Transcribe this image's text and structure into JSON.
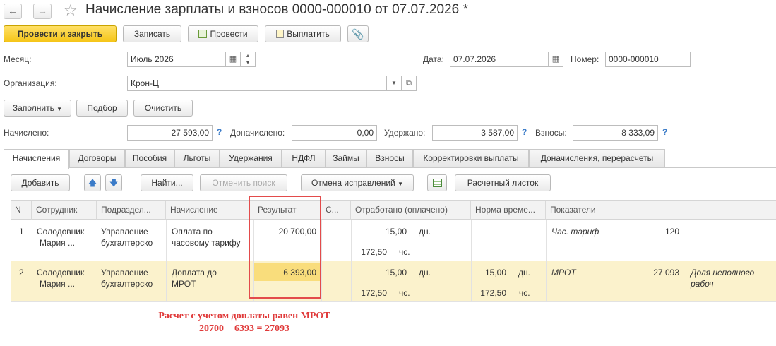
{
  "window": {
    "title": "Начисление зарплаты и взносов 0000-000010 от 07.07.2026 *",
    "back_icon": "←",
    "forward_icon": "→",
    "star_icon": "☆"
  },
  "toolbar": {
    "post_close": "Провести и закрыть",
    "save": "Записать",
    "post": "Провести",
    "pay": "Выплатить"
  },
  "header": {
    "month_label": "Месяц:",
    "month_value": "Июль 2026",
    "date_label": "Дата:",
    "date_value": "07.07.2026",
    "number_label": "Номер:",
    "number_value": "0000-000010",
    "org_label": "Организация:",
    "org_value": "Крон-Ц"
  },
  "actions": {
    "fill": "Заполнить",
    "select": "Подбор",
    "clear": "Очистить"
  },
  "totals": {
    "accrued_label": "Начислено:",
    "accrued_value": "27 593,00",
    "extra_label": "Доначислено:",
    "extra_value": "0,00",
    "withheld_label": "Удержано:",
    "withheld_value": "3 587,00",
    "contrib_label": "Взносы:",
    "contrib_value": "8 333,09",
    "help": "?"
  },
  "tabs": [
    "Начисления",
    "Договоры",
    "Пособия",
    "Льготы",
    "Удержания",
    "НДФЛ",
    "Займы",
    "Взносы",
    "Корректировки выплаты",
    "Доначисления, перерасчеты"
  ],
  "grid_toolbar": {
    "add": "Добавить",
    "find": "Найти...",
    "cancel_search": "Отменить поиск",
    "cancel_corrections": "Отмена исправлений",
    "payslip": "Расчетный листок"
  },
  "grid": {
    "columns": [
      "N",
      "Сотрудник",
      "Подраздел...",
      "Начисление",
      "Результат",
      "С...",
      "Отработано (оплачено)",
      "Норма време...",
      "Показатели"
    ],
    "rows": [
      {
        "n": "1",
        "employee_1": "Солодовник",
        "employee_2": "Мария ...",
        "dept_1": "Управление",
        "dept_2": "бухгалтерско",
        "accrual_1": "Оплата по",
        "accrual_2": "часовому тарифу",
        "result": "20 700,00",
        "worked_days": "15,00",
        "days_unit": "дн.",
        "worked_hours": "172,50",
        "hours_unit": "чс.",
        "indicator": "Час. тариф",
        "indicator_value": "120"
      },
      {
        "n": "2",
        "employee_1": "Солодовник",
        "employee_2": "Мария ...",
        "dept_1": "Управление",
        "dept_2": "бухгалтерско",
        "accrual_1": "Доплата до",
        "accrual_2": "МРОТ",
        "result": "6 393,00",
        "worked_days": "15,00",
        "days_unit": "дн.",
        "worked_hours": "172,50",
        "hours_unit": "чс.",
        "norm_days": "15,00",
        "norm_days_unit": "дн.",
        "norm_hours": "172,50",
        "norm_hours_unit": "чс.",
        "indicator": "МРОТ",
        "indicator_value": "27 093",
        "indicator2_1": "Доля неполного",
        "indicator2_2": "рабоч"
      }
    ]
  },
  "annotation": {
    "line1": "Расчет с учетом доплаты равен МРОТ",
    "line2": "20700 + 6393 = 27093"
  },
  "colors": {
    "primary_button": "#f5c518",
    "highlight_row": "#fbf2cc",
    "annotation": "#e03a3a",
    "help_icon": "#3a7bc8"
  }
}
